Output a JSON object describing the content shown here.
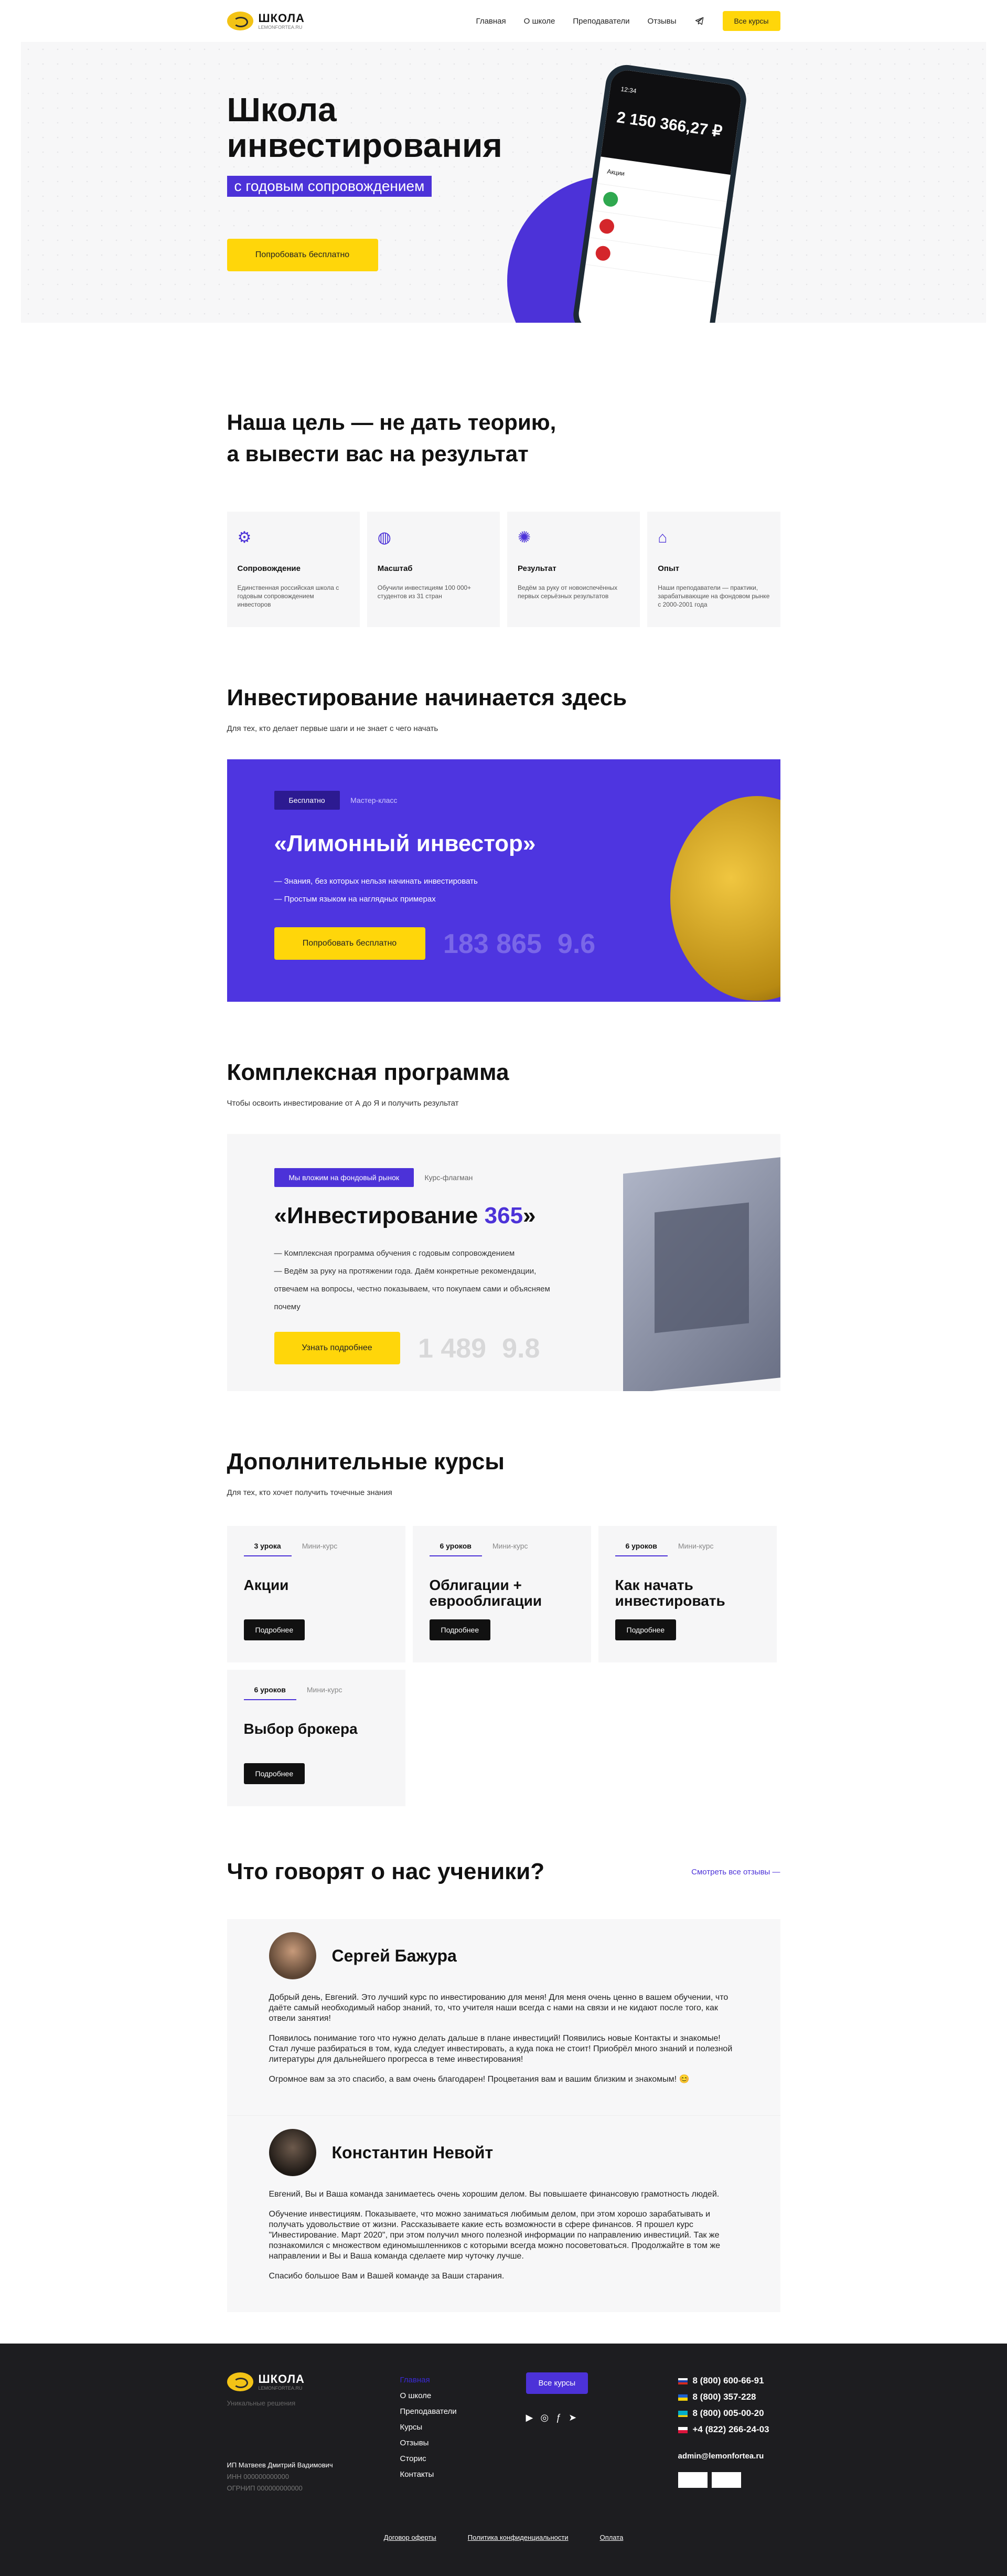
{
  "header": {
    "logo_title": "ШКОЛА",
    "logo_sub": "LEMONFORTEA.RU",
    "nav": [
      "Главная",
      "О школе",
      "Преподаватели",
      "Отзывы"
    ],
    "cta": "Все курсы"
  },
  "hero": {
    "title_line1": "Школа",
    "title_line2": "инвестирования",
    "tag": "с годовым сопровождением",
    "button": "Попробовать бесплатно",
    "phone_time": "12:34",
    "phone_balance": "2 150 366,27 ₽",
    "phone_section": "Акции"
  },
  "goal": {
    "title_line1": "Наша цель — не дать теорию,",
    "title_line2": "а вывести вас на результат",
    "cards": [
      {
        "icon": "gear-icon",
        "title": "Сопровождение",
        "desc": "Единственная российская школа с годовым сопровождением инвесторов"
      },
      {
        "icon": "globe-icon",
        "title": "Масштаб",
        "desc": "Обучили инвестициям 100 000+ студентов из 31 стран"
      },
      {
        "icon": "handshake-icon",
        "title": "Результат",
        "desc": "Ведём за руку от новоиспечённых первых серьёзных результатов"
      },
      {
        "icon": "building-icon",
        "title": "Опыт",
        "desc": "Наши преподаватели — практики, зарабатывающие на фондовом рынке с 2000-2001 года"
      }
    ]
  },
  "start": {
    "title": "Инвестирование начинается здесь",
    "sub": "Для тех, кто делает первые шаги и не знает с чего начать",
    "chip": "Бесплатно",
    "chip_alt": "Мастер-класс",
    "course": "«Лимонный инвестор»",
    "points": [
      "Знания, без которых нельзя начинать инвестировать",
      "Простым языком на наглядных примерах"
    ],
    "button": "Попробовать бесплатно",
    "stat1": "183 865",
    "stat2": "9.6"
  },
  "complex": {
    "title": "Комплексная программа",
    "sub": "Чтобы освоить инвестирование от А до Я и получить результат",
    "chip": "Мы вложим на фондовый рынок",
    "chip_alt": "Курс-флагман",
    "course_prefix": "«Инвестирование ",
    "course_accent": "365",
    "course_suffix": "»",
    "points": [
      "Комплексная программа обучения с годовым сопровождением",
      "Ведём за руку на протяжении года. Даём конкретные рекомендации, отвечаем на вопросы, честно показываем, что покупаем сами и объясняем почему"
    ],
    "button": "Узнать подробнее",
    "stat1": "1 489",
    "stat2": "9.8"
  },
  "additional": {
    "title": "Дополнительные курсы",
    "sub": "Для тех, кто хочет получить точечные знания",
    "courses": [
      {
        "count": "3 урока",
        "kind": "Мини-курс",
        "name": "Акции",
        "button": "Подробнее"
      },
      {
        "count": "6 уроков",
        "kind": "Мини-курс",
        "name": "Облигации + еврооблигации",
        "button": "Подробнее"
      },
      {
        "count": "6 уроков",
        "kind": "Мини-курс",
        "name": "Как начать инвестировать",
        "button": "Подробнее"
      },
      {
        "count": "6 уроков",
        "kind": "Мини-курс",
        "name": "Выбор брокера",
        "button": "Подробнее"
      }
    ]
  },
  "reviews": {
    "title": "Что говорят о нас ученики?",
    "all_link": "Смотреть все отзывы —",
    "items": [
      {
        "name": "Сергей Бажура",
        "paragraphs": [
          "Добрый день, Евгений. Это лучший курс по инвестированию для меня! Для меня очень ценно в вашем обучении, что даёте самый необходимый набор знаний, то, что учителя наши всегда с нами на связи и не кидают после того, как отвели занятия!",
          "Появилось понимание того что нужно делать дальше в плане инвестиций! Появились новые Контакты и знакомые! Стал лучше разбираться в том, куда следует инвестировать, а куда пока не стоит! Приобрёл много знаний и полезной литературы для дальнейшего прогресса в теме инвестирования!",
          "Огромное вам за это спасибо, а вам очень благодарен! Процветания вам и вашим близким и знакомым! 😊"
        ]
      },
      {
        "name": "Константин Невойт",
        "paragraphs": [
          "Евгений, Вы и Ваша команда занимаетесь очень хорошим делом. Вы повышаете финансовую грамотность людей.",
          "Обучение инвестициям. Показываете, что можно заниматься любимым делом, при этом хорошо зарабатывать и получать удовольствие от жизни. Рассказываете какие есть возможности в сфере финансов. Я прошел курс \"Инвестирование. Март 2020\", при этом получил много полезной информации по направлению инвестиций. Так же познакомился с множеством единомышленников с которыми всегда можно посоветоваться. Продолжайте в том же направлении и Вы и Ваша команда сделаете мир чуточку лучше.",
          "Спасибо большое Вам и Вашей команде за Ваши старания."
        ]
      }
    ]
  },
  "footer": {
    "logo_title": "ШКОЛА",
    "logo_sub": "LEMONFORTEA.RU",
    "slogan": "Уникальные решения",
    "legal": "ИП Матвеев Дмитрий Вадимович",
    "legal2": "ИНН 000000000000",
    "legal3": "ОГРНИП 000000000000",
    "menu_active": "Главная",
    "menu": [
      "О школе",
      "Преподаватели",
      "Курсы",
      "Отзывы",
      "Сторис",
      "Контакты"
    ],
    "cta": "Все курсы",
    "phones": [
      "8 (800) 600-66-91",
      "8 (800) 357-228",
      "8 (800) 005-00-20",
      "+4 (822) 266-24-03"
    ],
    "email": "admin@lemonfortea.ru",
    "bottom_links": [
      "Договор оферты",
      "Политика конфиденциальности",
      "Оплата"
    ]
  },
  "colors": {
    "accent": "#4c32d8",
    "yellow": "#ffd60a",
    "footer_bg": "#1d1d20"
  }
}
